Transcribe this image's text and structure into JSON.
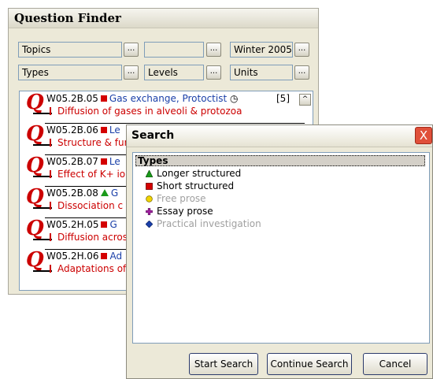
{
  "finder": {
    "title": "Question Finder",
    "topics_label": "Topics",
    "blank_value": "",
    "session_value": "Winter 2005",
    "types_label": "Types",
    "levels_label": "Levels",
    "units_label": "Units",
    "browse_label": "...",
    "scroll_up": "^"
  },
  "questions": [
    {
      "code": "W05.2B.05",
      "type_color": "#d40000",
      "topic": "Gas exchange, Protoctist",
      "clock": "◷",
      "mark": "[5]",
      "desc": "Diffusion of gases in alveoli & protozoa"
    },
    {
      "code": "W05.2B.06",
      "type_color": "#d40000",
      "topic": "Le",
      "desc": "Structure & fun"
    },
    {
      "code": "W05.2B.07",
      "type_color": "#d40000",
      "topic": "Le",
      "desc": "Effect of K+ io"
    },
    {
      "code": "W05.2B.08",
      "type_color": "#1a9a1a",
      "topic": "G",
      "desc": "Dissociation c"
    },
    {
      "code": "W05.2H.05",
      "type_color": "#d40000",
      "topic": "G",
      "desc": "Diffusion acros"
    },
    {
      "code": "W05.2H.06",
      "type_color": "#d40000",
      "topic": "Ad",
      "desc": "Adaptations of"
    }
  ],
  "search": {
    "title": "Search",
    "close": "X",
    "tree_header": "Types",
    "items": [
      {
        "label": "Longer structured",
        "icon": "green-triangle",
        "color": "#1a9a1a",
        "enabled": true
      },
      {
        "label": "Short structured",
        "icon": "red-square",
        "color": "#d40000",
        "enabled": true
      },
      {
        "label": "Free prose",
        "icon": "yellow-circle",
        "color": "#e8c800",
        "enabled": false
      },
      {
        "label": "Essay prose",
        "icon": "purple-cross",
        "color": "#a020a0",
        "enabled": true
      },
      {
        "label": "Practical investigation",
        "icon": "blue-diamond",
        "color": "#1a3fa8",
        "enabled": false
      }
    ],
    "start_button": "Start Search",
    "continue_button": "Continue Search",
    "cancel_button": "Cancel"
  }
}
